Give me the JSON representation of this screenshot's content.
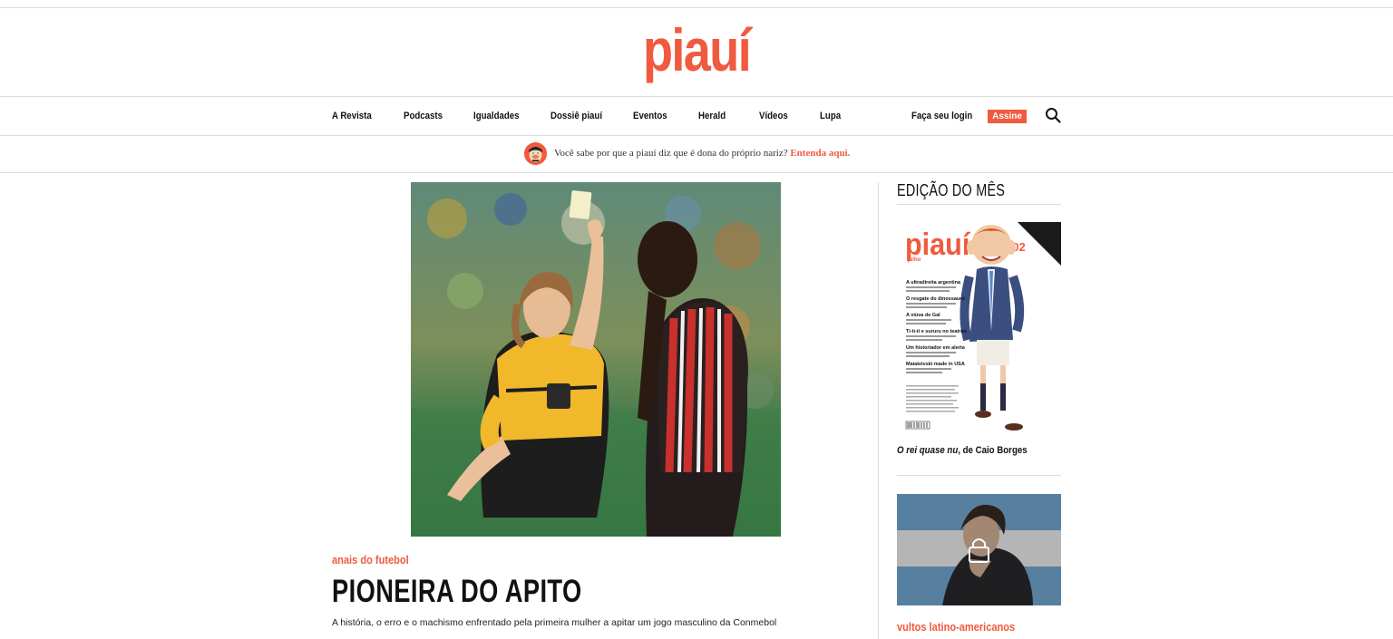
{
  "brand": {
    "logo_text": "piauí",
    "accent_color": "#f05a3e"
  },
  "nav": {
    "items": [
      {
        "label": "A Revista"
      },
      {
        "label": "Podcasts"
      },
      {
        "label": "Igualdades"
      },
      {
        "label": "Dossiê piauí"
      },
      {
        "label": "Eventos"
      },
      {
        "label": "Herald"
      },
      {
        "label": "Vídeos"
      },
      {
        "label": "Lupa"
      }
    ],
    "login_label": "Faça seu login",
    "subscribe_label": "Assine",
    "search_icon": "search-icon"
  },
  "notice": {
    "text": "Você sabe por que a piauí diz que é dona do próprio nariz?",
    "link_label": "Entenda aqui."
  },
  "main_story": {
    "kicker": "anais do futebol",
    "headline": "PIONEIRA DO APITO",
    "dek": "A história, o erro e o machismo enfrentado pela primeira mulher a apitar um jogo masculino da Conmebol"
  },
  "sidebar": {
    "section_title": "EDIÇÃO DO MÊS",
    "cover": {
      "logo": "piauí",
      "month": "julho",
      "issue_number": "202",
      "headlines": [
        "A ultradireita argentina",
        "O resgate do dinossauro",
        "A viúva de Gal",
        "Ti-ti-ti e sururu no teatrão",
        "Um historiador em alerta",
        "Maiakóvski made in USA"
      ]
    },
    "cover_caption_italic": "O rei quase nu",
    "cover_caption_rest": ", de Caio Borges",
    "second_story_kicker": "vultos latino-americanos",
    "lock_icon": "lock-icon"
  }
}
